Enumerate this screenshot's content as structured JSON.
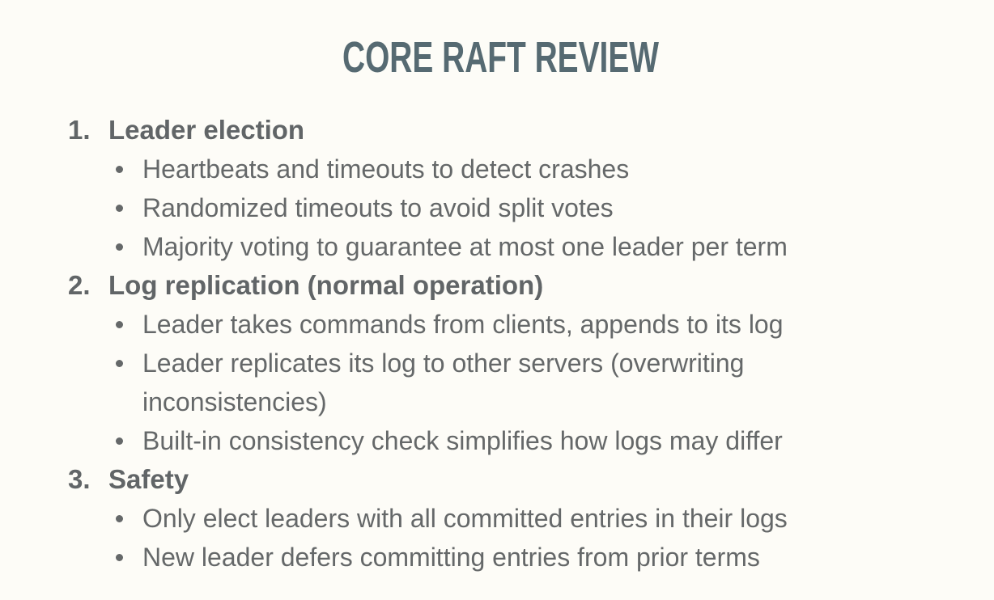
{
  "title": "CORE RAFT REVIEW",
  "sections": [
    {
      "number": "1.",
      "label": "Leader election",
      "bullets": [
        "Heartbeats and timeouts to detect crashes",
        "Randomized timeouts to avoid split votes",
        "Majority voting to guarantee at most one leader per term"
      ]
    },
    {
      "number": "2.",
      "label": "Log replication (normal operation)",
      "bullets": [
        "Leader takes commands from clients, appends to its log",
        "Leader replicates its log to other servers (overwriting inconsistencies)",
        "Built-in consistency check simplifies how logs may differ"
      ]
    },
    {
      "number": "3.",
      "label": "Safety",
      "bullets": [
        "Only elect leaders with all committed entries in their logs",
        "New leader defers committing entries from prior terms"
      ]
    }
  ]
}
